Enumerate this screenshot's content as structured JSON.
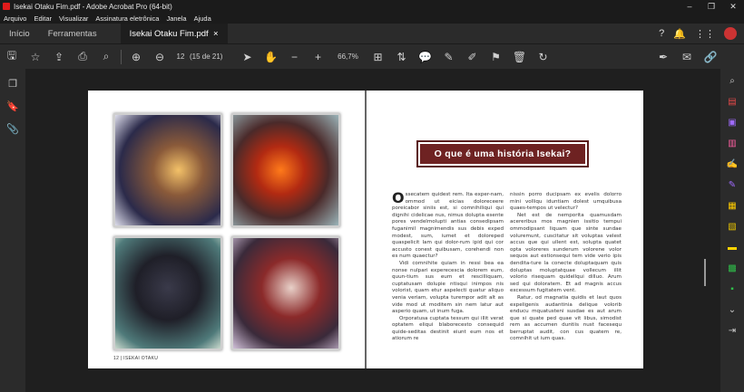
{
  "window": {
    "title": "Isekai Otaku Fim.pdf - Adobe Acrobat Pro (64-bit)",
    "controls": [
      "–",
      "❐",
      "✕"
    ]
  },
  "menu": [
    "Arquivo",
    "Editar",
    "Visualizar",
    "Assinatura eletrônica",
    "Janela",
    "Ajuda"
  ],
  "tabs": {
    "home": "Início",
    "tools": "Ferramentas",
    "doc": "Isekai Otaku Fim.pdf",
    "doc_close": "×"
  },
  "toolbar": {
    "page_current": "12",
    "page_info": "(15 de 21)",
    "zoom": "66,7%"
  },
  "left_page": {
    "footer": "12 | ISEKAI OTAKU"
  },
  "right_page": {
    "heading": "O que é uma história Isekai?",
    "dropcap": "O",
    "col1_p1": "ssecatem quidest rem. Ita exper-nam, ommod ut eicias doloreceere poreicabor siniis est, si comnihiliqui qui dignihi cidelicae nus, nimus dolupta esente pores vendelmolupti antias consedipsam fuganimil magnimendis sus debis exped modest, sum, iumet et doloreped quaspelicit lam qui dolor-rum ipid qui cor accusto conest quibusam, corehendi non es num quaectur?",
    "col1_p2": "Vidi comnihite quiam in ressi bea ea nonse nulpari experecescia dolorem eum, quun-tium sus eum et rescilliquam, cuptatusam dolupie ntisqui inimpos nis volorist, quam etur aspelecti quatur aliquo venia veriam, volupta turempor adit alt as vide mod ut moditem sin nem latur aut asperio quam, ut inum fuga.",
    "col1_p3": "Orporatusa cuptata tessum qui illit verat optatem eliqui blaborecesto consequid quide-seditas destinit eiunt eum nos et atiorum re",
    "col2_p1": "nissin porro ducipsam ex evelis dolorro mini volliqu iduntiam dolest umquibusa quaes-tempos ut velectur?",
    "col2_p2": "Net est de nemporita quamusdam acereribus mos magnien issitio tempui ommodipsant liquam que sinte sundae voluremunt, cuscitatur sit voluptas velest accus que qui ullent est, solupta quatet opta voloreres sunderum volorene volor sequos aut estionsequi tem vide verio ipis dendita-ture la conecte doluptaquam quis doluptas moluptatquae vollecum illit volorio risequam quidellqui dilluo. Arum sed qui doloratem. Et ad magnis accus excessum fugitatem vent.",
    "col2_p3": "Ratur, od magnatia quidis et laut quos expeligenis audantinia delique volorib enducu mquatusteni susdae es aut arum que si quate ped quae vit libus, simodist rem as accumen duntiis nust facesequ berruptat audit, con cus quatem re, comnihit ut ium quas."
  },
  "colors": {
    "accent": "#6e2222",
    "adobe_red": "#e01b1b",
    "chrome": "#2b2b2b"
  }
}
